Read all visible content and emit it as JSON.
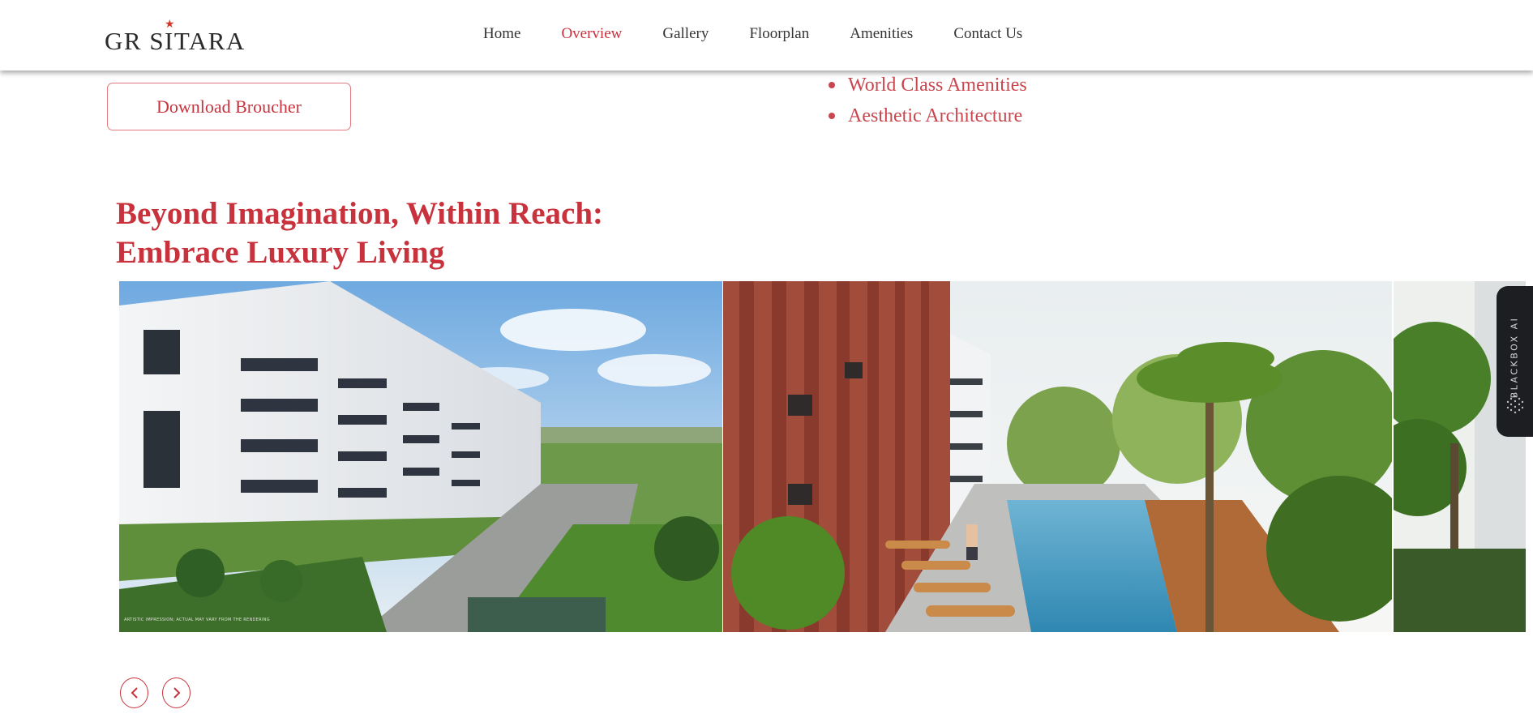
{
  "header": {
    "logo_text": "GR SITARA",
    "nav": [
      {
        "label": "Home",
        "active": false
      },
      {
        "label": "Overview",
        "active": true
      },
      {
        "label": "Gallery",
        "active": false
      },
      {
        "label": "Floorplan",
        "active": false
      },
      {
        "label": "Amenities",
        "active": false
      },
      {
        "label": "Contact Us",
        "active": false
      }
    ]
  },
  "overview": {
    "download_label": "Download Broucher",
    "features": [
      "World Class Amenities",
      "Aesthetic Architecture"
    ]
  },
  "section": {
    "title_line1": "Beyond Imagination, Within Reach:",
    "title_line2": "Embrace Luxury Living"
  },
  "gallery": {
    "caption": "ARTISTIC IMPRESSION; ACTUAL MAY VARY FROM THE RENDERING"
  },
  "sidebar_widget": {
    "label": "BLACKBOX AI"
  },
  "colors": {
    "accent": "#c8323c",
    "widget_bg": "#1c1e22"
  },
  "icons": {
    "prev": "chevron-left-icon",
    "next": "chevron-right-icon",
    "logo_star": "star-icon"
  }
}
